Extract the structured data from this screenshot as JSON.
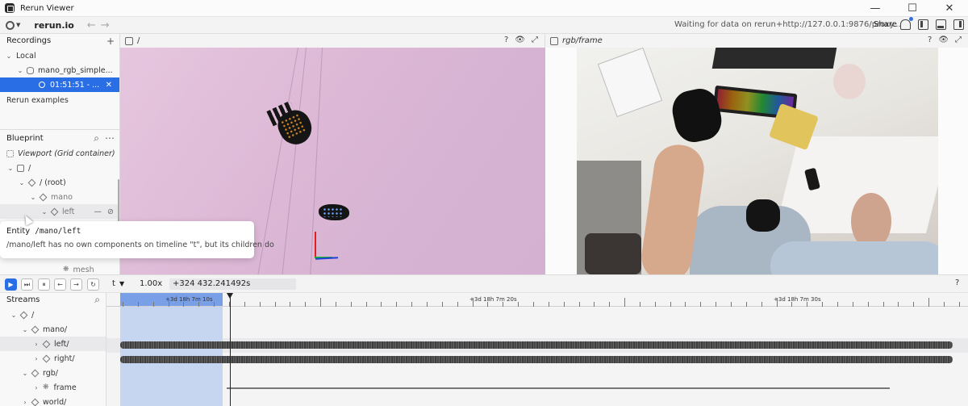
{
  "window": {
    "title": "Rerun Viewer",
    "minimize": "—",
    "maximize": "☐",
    "close": "✕"
  },
  "toolbar": {
    "brand": "rerun.io",
    "back": "←",
    "forward": "→",
    "status": "Waiting for data on rerun+http://127.0.0.1:9876/proxy...",
    "share": "Share"
  },
  "recordings": {
    "title": "Recordings",
    "add": "+",
    "local": "Local",
    "app": "mano_rgb_simple...",
    "recording": "01:51:51 - ...",
    "close": "✕",
    "examples": "Rerun examples"
  },
  "blueprint": {
    "title": "Blueprint",
    "viewport": "Viewport (Grid container)",
    "items": [
      {
        "label": "/"
      },
      {
        "label": "/ (root)"
      },
      {
        "label": "mano"
      },
      {
        "label": "left"
      },
      {
        "label": "mesh"
      }
    ],
    "hide": "—"
  },
  "tooltip": {
    "kind": "Entity",
    "path": "/mano/left",
    "message": "/mano/left has no own components on timeline \"t\", but its children do"
  },
  "view3d": {
    "title": "/",
    "help": "?",
    "eye": "👁",
    "maximize": "⤢"
  },
  "view2d": {
    "title": "rgb/frame",
    "help": "?",
    "eye": "👁",
    "maximize": "⤢"
  },
  "timeline": {
    "play": "▶",
    "step": "⏭",
    "pause": "⏸",
    "prev": "←",
    "next": "→",
    "loop": "↻",
    "timeline_name": "t",
    "speed": "1.00x",
    "current_time": "+324 432.241492s",
    "help": "?",
    "tick_labels": [
      "+3d 18h 7m 10s",
      "+3d 18h 7m 20s",
      "+3d 18h 7m 30s"
    ]
  },
  "streams": {
    "title": "Streams",
    "items": [
      {
        "label": "/"
      },
      {
        "label": "mano/"
      },
      {
        "label": "left/"
      },
      {
        "label": "right/"
      },
      {
        "label": "rgb/"
      },
      {
        "label": "frame"
      },
      {
        "label": "world/"
      }
    ]
  },
  "colors": {
    "accent": "#2a6ee6",
    "selection": "#c6d6f0",
    "axis_x": "#e02020",
    "axis_y": "#19b23a",
    "axis_z": "#1f3fd6"
  }
}
